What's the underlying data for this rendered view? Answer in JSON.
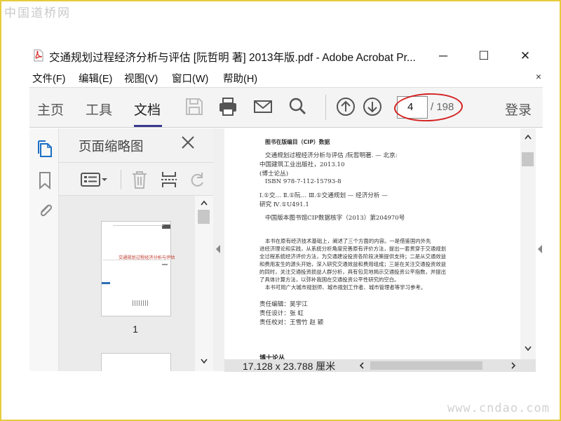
{
  "watermarks": {
    "top": "中国道桥网",
    "bottom": "www.cndao.com"
  },
  "window": {
    "title": "交通规划过程经济分析与评估 [阮哲明 著] 2013年版.pdf - Adobe Acrobat Pr...",
    "minimize": "─",
    "maximize": "☐",
    "close": "✕"
  },
  "menu": {
    "items": [
      "文件(F)",
      "编辑(E)",
      "视图(V)",
      "窗口(W)",
      "帮助(H)"
    ],
    "close": "×"
  },
  "toolbar": {
    "tabs": [
      "主页",
      "工具",
      "文档"
    ],
    "active_tab": "文档",
    "page_current": "4",
    "page_total": "/ 198",
    "login": "登录",
    "accent_color": "#3a3a8e",
    "highlight_color": "#d42020"
  },
  "thumbnails_panel": {
    "title": "页面缩略图",
    "thumbnails": [
      {
        "label": "1",
        "cover_title": "交通规划过程经济分析与评估",
        "cover_tag": "博士论丛"
      }
    ]
  },
  "document": {
    "cip_heading": "图书在版编目（CIP）数据",
    "lines": [
      "交通规划过程经济分析与评估 /阮哲明著. — 北京:",
      "中国建筑工业出版社，2013.10",
      "(博士论丛)",
      "ISBN 978-7-112-15793-8",
      "Ⅰ.①交…  Ⅱ.①阮…  Ⅲ.①交通规划 — 经济分析 —",
      "研究  Ⅳ.①U491.1",
      "中国版本图书馆CIP数据核字（2013）第204970号"
    ],
    "abstract": [
      "本书在原有经济技术基础上，阐述了三个方面的内容。一是借鉴国内外先",
      "进经济理论和实践，从系统分析角度完善原有评价方法，提出一套贯穿于交通规划",
      "全过程系统经济评价方法，为交通建设投资各阶段决策提供支持；二是从交通效益",
      "和费用发生的源头开始，深入研究交通效益和费用组成；三是在关注交通投资效益",
      "的同时，关注交通投资损益人群分析，具有包见地揭示交通投资公平指数，并提出",
      "了具体计算方法，以弥补我国在交通投资公平性研究的空白。",
      "本书可用广大城市规划师、城市规划工作者、城市管理者等学习参考。"
    ],
    "credits": [
      "责任编辑：吴宇江",
      "责任设计：张    虹",
      "责任校对：王雪竹    赵    颖"
    ],
    "footer_text": "博士论丛"
  },
  "status": {
    "page_size": "17.128 x 23.788 厘米"
  },
  "icons": [
    "pdf-icon",
    "save-icon",
    "print-icon",
    "mail-icon",
    "search-icon",
    "arrow-up-icon",
    "arrow-down-icon",
    "pages-icon",
    "bookmark-icon",
    "attachment-icon",
    "close-icon",
    "options-icon",
    "trash-icon",
    "insert-icon",
    "rotate-icon"
  ]
}
